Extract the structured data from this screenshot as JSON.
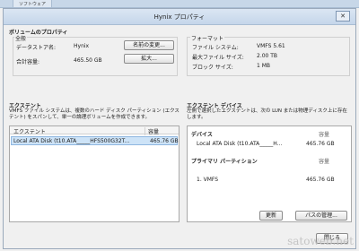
{
  "background": {
    "tab_label": "ソフトウェア"
  },
  "dialog": {
    "title": "Hynix プロパティ",
    "close_label": "✕",
    "volume_props": {
      "heading": "ボリュームのプロパティ",
      "general": "全般",
      "datastore_name_label": "データストア名:",
      "datastore_name_value": "Hynix",
      "total_capacity_label": "合計容量:",
      "total_capacity_value": "465.50 GB",
      "rename_button": "名前の変更...",
      "expand_button": "拡大..."
    },
    "format": {
      "heading": "フォーマット",
      "fs_label": "ファイル システム:",
      "fs_value": "VMFS 5.61",
      "max_file_label": "最大ファイル サイズ:",
      "max_file_value": "2.00 TB",
      "block_label": "ブロック サイズ:",
      "block_value": "1 MB"
    },
    "extents": {
      "heading": "エクステント",
      "description": "VMFS ファイル システムは、複数のハード ディスク パーティション (エクステント) をスパンして、単一の論理ボリュームを作成できます。",
      "col_extent": "エクステント",
      "col_capacity": "容量",
      "rows": [
        {
          "name": "Local ATA Disk (t10.ATA_____HFS500G32T...",
          "capacity": "465.76 GB"
        }
      ]
    },
    "extent_device": {
      "heading": "エクステント デバイス",
      "description": "左側で選択したエクステントは、次の LUN または物理ディスク上に存在します。",
      "device_label": "デバイス",
      "capacity_label": "容量",
      "device_name": "Local ATA Disk (t10.ATA_____H...",
      "device_capacity": "465.76 GB",
      "partition_label": "プライマリ パーティション",
      "partition_capacity_label": "容量",
      "partition_name": "1. VMFS",
      "partition_capacity": "465.76 GB",
      "refresh_button": "更新",
      "path_button": "パスの管理..."
    },
    "close_button": "閉じる"
  },
  "watermark": "satoweb.net"
}
